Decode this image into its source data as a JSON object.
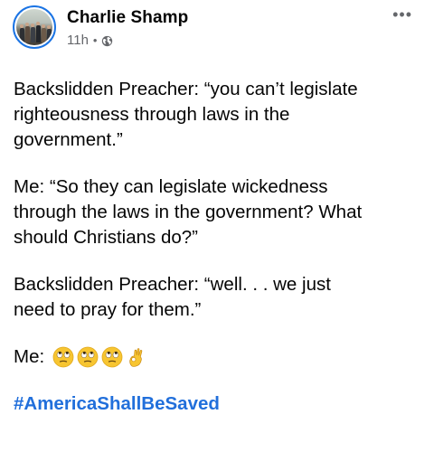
{
  "post": {
    "author": "Charlie Shamp",
    "time": "11h",
    "separator": "•",
    "privacy_icon": "globe-icon",
    "more_icon": "more-options-icon",
    "more_glyph": "•••",
    "paragraphs": [
      "Backslidden Preacher: “you can’t legislate\nrighteousness through laws in the\ngovernment.”",
      "Me: “So they can legislate wickedness\nthrough the laws in the government? What\nshould Christians do?”",
      "Backslidden Preacher: “well. . . we just\nneed to pray for them.”"
    ],
    "reaction_line": {
      "label": "Me:",
      "emojis": [
        "face-with-rolling-eyes-emoji",
        "face-with-rolling-eyes-emoji",
        "face-with-rolling-eyes-emoji",
        "ok-hand-emoji"
      ]
    },
    "hashtag": "#AmericaShallBeSaved"
  },
  "colors": {
    "accent": "#1b74e4",
    "hashtag": "#216fdb",
    "text": "#050505",
    "secondary": "#65676b",
    "emoji_yellow": "#f7c531"
  }
}
